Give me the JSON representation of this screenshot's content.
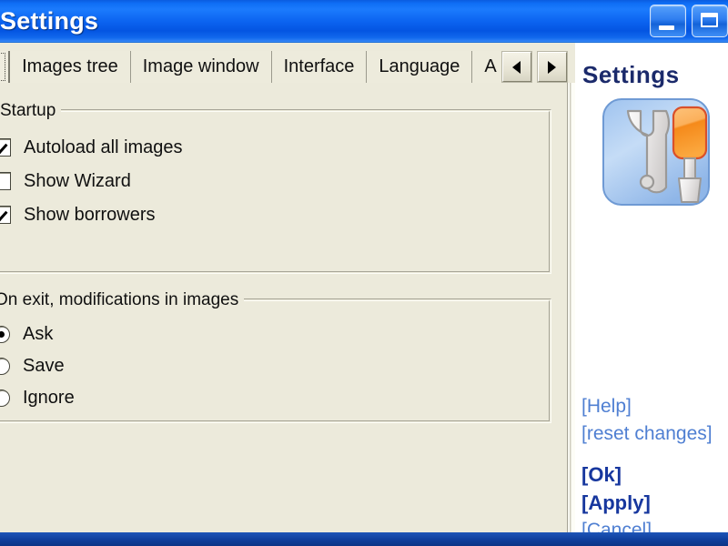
{
  "window": {
    "title": "Settings",
    "minimize_label": "Minimize",
    "maximize_label": "Maximize",
    "titlebar_color": "#0f6ef5"
  },
  "tabs": {
    "items": [
      {
        "label": "n",
        "selected": true
      },
      {
        "label": "Images tree",
        "selected": false
      },
      {
        "label": "Image window",
        "selected": false
      },
      {
        "label": "Interface",
        "selected": false
      },
      {
        "label": "Language",
        "selected": false
      },
      {
        "label": "A",
        "selected": false
      }
    ],
    "scroll_left_label": "◀",
    "scroll_right_label": "▶"
  },
  "main": {
    "groups": [
      {
        "title": "Startup",
        "options": [
          {
            "label": "Autoload all images",
            "type": "checkbox",
            "checked": true
          },
          {
            "label": "Show Wizard",
            "type": "checkbox",
            "checked": false
          },
          {
            "label": "Show borrowers",
            "type": "checkbox",
            "checked": true
          }
        ]
      },
      {
        "title": "On exit, modifications in images",
        "options": [
          {
            "label": "Ask",
            "type": "radio",
            "checked": true
          },
          {
            "label": "Save",
            "type": "radio",
            "checked": false
          },
          {
            "label": "Ignore",
            "type": "radio",
            "checked": false
          }
        ]
      }
    ]
  },
  "sidebar": {
    "heading": "Settings",
    "icon_name": "wrench-screwdriver-icon",
    "links": [
      {
        "label": "[Help]",
        "style": "normal"
      },
      {
        "label": "[reset changes]",
        "style": "normal"
      },
      {
        "label": "[Ok]",
        "style": "primary"
      },
      {
        "label": "[Apply]",
        "style": "primary"
      },
      {
        "label": "[Cancel]",
        "style": "normal"
      }
    ],
    "heading_color": "#1b2a6b",
    "link_color": "#4f7fd2",
    "primary_link_color": "#17379e"
  }
}
